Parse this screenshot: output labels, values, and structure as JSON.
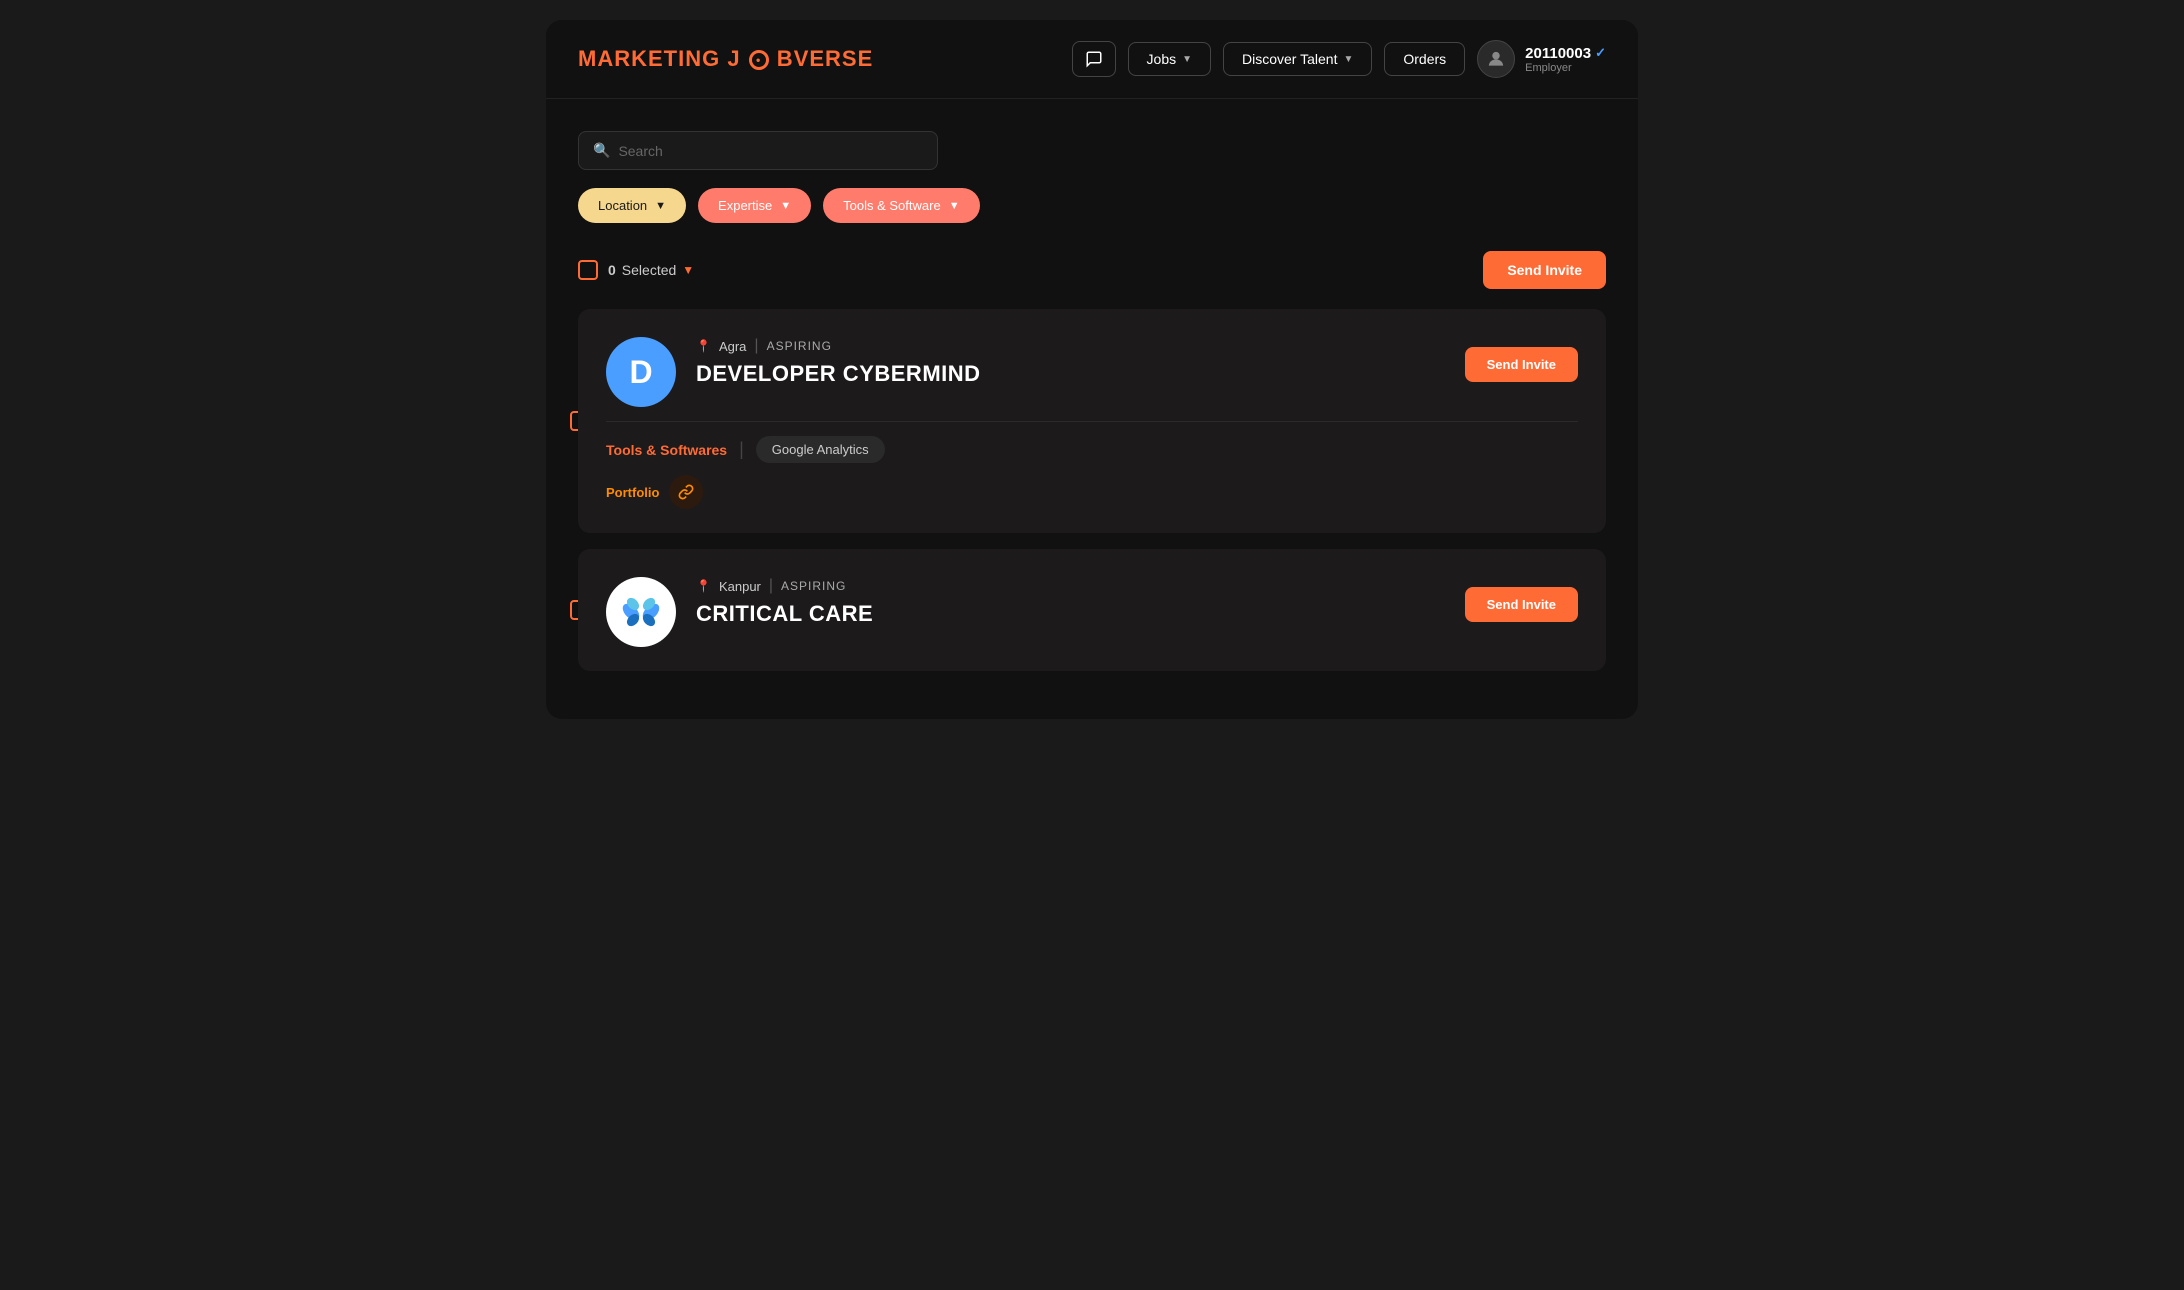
{
  "app": {
    "logo": "MARKETING JÖBVERSE"
  },
  "header": {
    "chat_button": "💬",
    "jobs_label": "Jobs",
    "discover_talent_label": "Discover Talent",
    "orders_label": "Orders",
    "user_id": "20110003",
    "user_role": "Employer",
    "verified": true
  },
  "search": {
    "placeholder": "Search"
  },
  "filters": {
    "location_label": "Location",
    "expertise_label": "Expertise",
    "tools_label": "Tools & Software"
  },
  "selection": {
    "count": "0",
    "label": "Selected",
    "send_invite": "Send Invite"
  },
  "candidates": [
    {
      "id": "developer-cybermind",
      "avatar_letter": "D",
      "avatar_type": "letter",
      "location": "Agra",
      "type": "ASPIRING",
      "name": "DEVELOPER CYBERMIND",
      "tools_label": "Tools & Softwares",
      "tools": [
        "Google Analytics"
      ],
      "portfolio_label": "Portfolio",
      "send_invite": "Send Invite"
    },
    {
      "id": "critical-care",
      "avatar_letter": "",
      "avatar_type": "logo",
      "location": "Kanpur",
      "type": "ASPIRING",
      "name": "CRITICAL CARE",
      "tools_label": "",
      "tools": [],
      "portfolio_label": "",
      "send_invite": "Send Invite"
    }
  ]
}
